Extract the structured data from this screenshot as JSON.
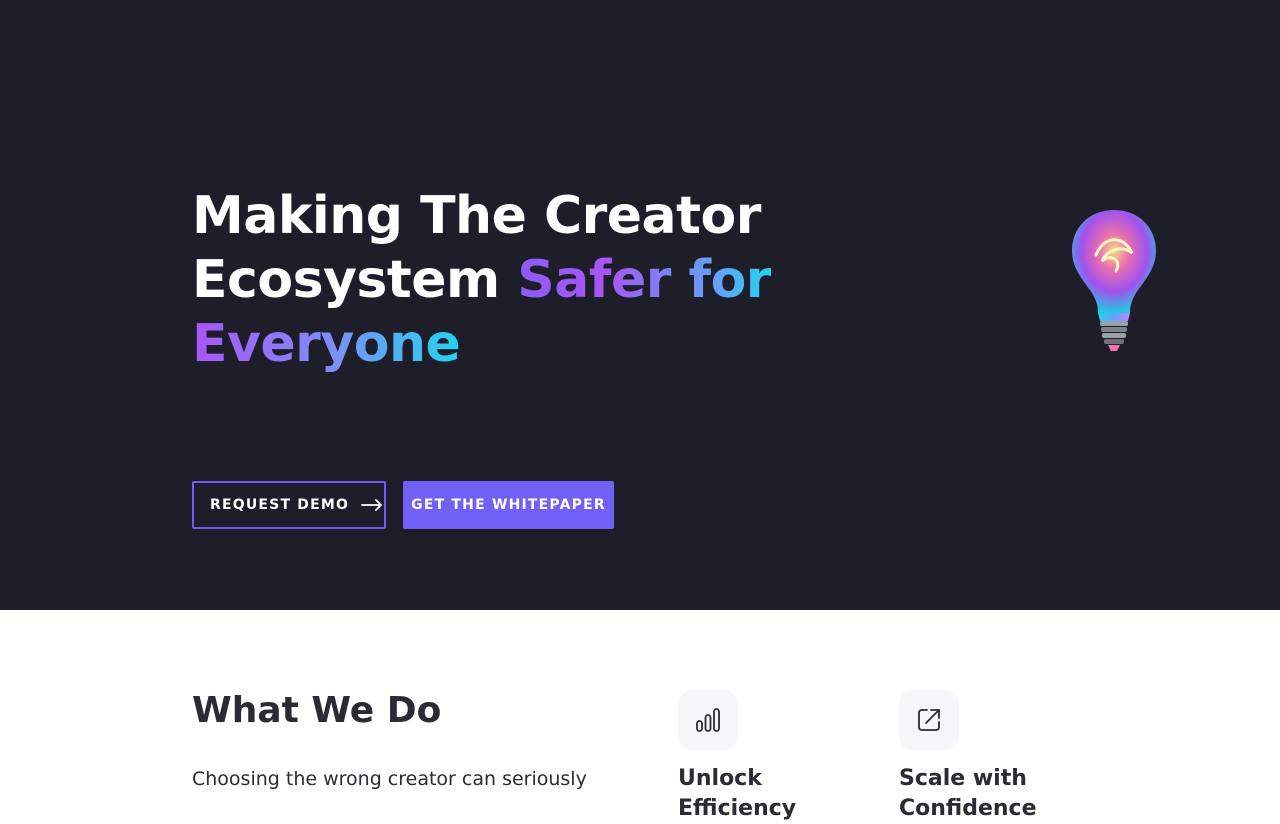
{
  "hero": {
    "title_line1": "Making The Creator",
    "title_line2_plain": "Ecosystem ",
    "title_line2_accent": "Safer for",
    "title_line3_accent": "Everyone",
    "demo_button_label": "REQUEST DEMO",
    "whitepaper_button_label": "GET THE WHITEPAPER"
  },
  "what_we_do": {
    "title": "What We Do",
    "text": "Choosing the wrong creator can seriously"
  },
  "features": [
    {
      "icon": "bar-chart-icon",
      "title": "Unlock Efficiency"
    },
    {
      "icon": "external-link-icon",
      "title": "Scale with Confidence"
    }
  ],
  "colors": {
    "hero_bg": "#1e1e2a",
    "accent": "#7060f6",
    "text_dark": "#2b2b33"
  }
}
